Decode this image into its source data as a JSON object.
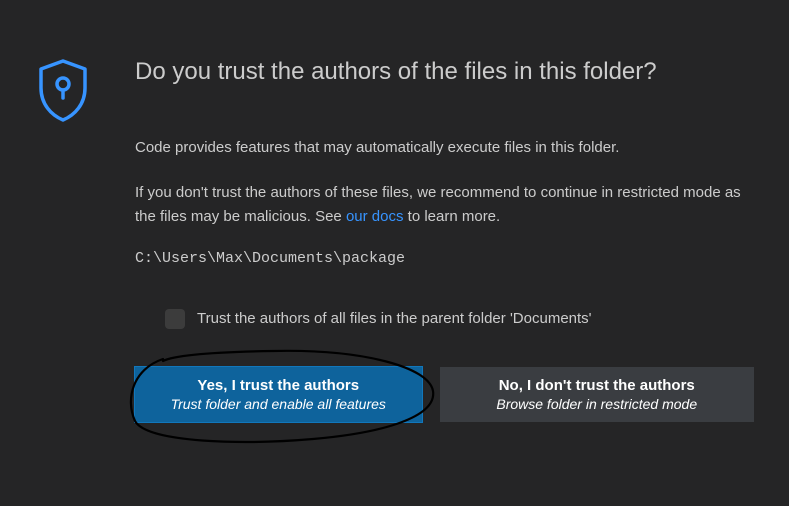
{
  "dialog": {
    "title": "Do you trust the authors of the files in this folder?",
    "paragraph1": "Code provides features that may automatically execute files in this folder.",
    "paragraph2_before": "If you don't trust the authors of these files, we recommend to continue in restricted mode as the files may be malicious. See ",
    "paragraph2_link": "our docs",
    "paragraph2_after": " to learn more.",
    "path": "C:\\Users\\Max\\Documents\\package",
    "checkbox_label": "Trust the authors of all files in the parent folder 'Documents'"
  },
  "buttons": {
    "trust": {
      "title": "Yes, I trust the authors",
      "subtitle": "Trust folder and enable all features"
    },
    "no_trust": {
      "title": "No, I don't trust the authors",
      "subtitle": "Browse folder in restricted mode"
    }
  },
  "colors": {
    "accent": "#3794ff",
    "primary_button": "#0e639c"
  }
}
